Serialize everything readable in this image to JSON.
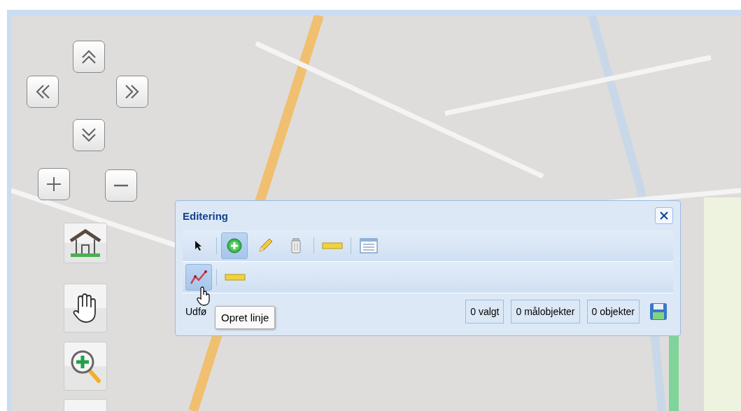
{
  "panel": {
    "title": "Editering",
    "toolbar": [
      {
        "kind": "pointer",
        "selected": false
      },
      {
        "kind": "separator"
      },
      {
        "kind": "add",
        "selected": true
      },
      {
        "kind": "edit",
        "selected": false
      },
      {
        "kind": "delete",
        "selected": false
      },
      {
        "kind": "separator"
      },
      {
        "kind": "measure",
        "selected": false
      },
      {
        "kind": "separator"
      },
      {
        "kind": "list",
        "selected": false
      }
    ],
    "subtoolbar": [
      {
        "kind": "line",
        "selected": true
      },
      {
        "kind": "separator"
      },
      {
        "kind": "measure",
        "selected": false
      }
    ],
    "status": "Udfø",
    "counters": [
      "0 valgt",
      "0 målobjekter",
      "0 objekter"
    ],
    "tooltip": "Opret linje"
  }
}
